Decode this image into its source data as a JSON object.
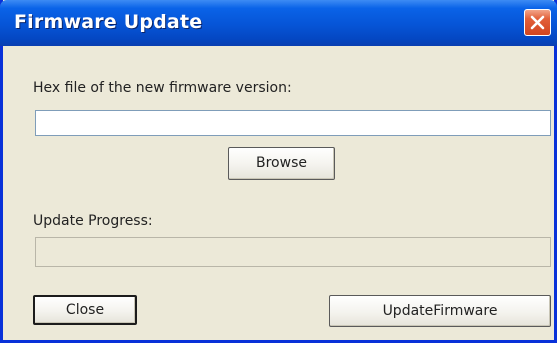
{
  "window": {
    "title": "Firmware Update"
  },
  "file": {
    "label": "Hex file of the new firmware version:",
    "value": "",
    "browse_label": "Browse"
  },
  "progress": {
    "label": "Update Progress:",
    "value": 0
  },
  "buttons": {
    "close_label": "Close",
    "update_label": "UpdateFirmware"
  },
  "icons": {
    "close": "close-icon"
  },
  "colors": {
    "titlebar": "#0654d6",
    "close_button": "#d2451f",
    "window_background": "#ece9d8"
  }
}
